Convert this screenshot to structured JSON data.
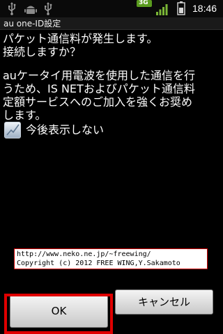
{
  "status_bar": {
    "network": "3G",
    "time": "18:46",
    "icons": [
      "usb-icon",
      "android-debug-icon",
      "usb-icon",
      "network-3g-icon",
      "signal-icon",
      "battery-icon"
    ]
  },
  "dialog": {
    "title": "au one-ID設定",
    "message1": [
      "パケット通信料が発生します。",
      "接続しますか？"
    ],
    "message2": [
      "auケータイ用電波を使用した通信を行",
      "うため、IS NETおよびパケット通信料",
      "定額サービスへのご加入を強くお奨め",
      "します。"
    ],
    "checkbox_label": "今後表示しない",
    "checkbox_checked": true,
    "ok_label": "OK",
    "cancel_label": "キャンセル"
  },
  "credit": {
    "line1": "http://www.neko.ne.jp/~freewing/",
    "line2": "Copyright (c) 2012 FREE WING,Y.Sakamoto"
  }
}
